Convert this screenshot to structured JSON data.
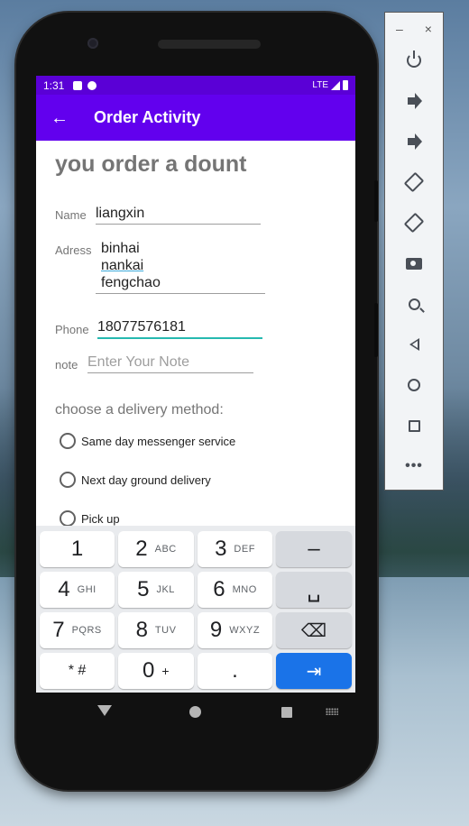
{
  "status_bar": {
    "time": "1:31",
    "network": "LTE"
  },
  "app_bar": {
    "back_glyph": "←",
    "title": "Order Activity"
  },
  "form": {
    "heading": "you order a dount",
    "name_label": "Name",
    "name_value": "liangxin",
    "address_label": "Adress",
    "address_lines": [
      "binhai",
      "nankai",
      "fengchao"
    ],
    "phone_label": "Phone",
    "phone_value": "18077576181",
    "note_label": "note",
    "note_placeholder": "Enter Your Note"
  },
  "delivery": {
    "title": "choose a delivery method:",
    "options": [
      "Same day messenger service",
      "Next day ground delivery",
      "Pick up"
    ]
  },
  "keyboard": {
    "keys": [
      {
        "main": "1",
        "sub": ""
      },
      {
        "main": "2",
        "sub": "ABC"
      },
      {
        "main": "3",
        "sub": "DEF"
      },
      {
        "main": "–",
        "sub": ""
      },
      {
        "main": "4",
        "sub": "GHI"
      },
      {
        "main": "5",
        "sub": "JKL"
      },
      {
        "main": "6",
        "sub": "MNO"
      },
      {
        "main": "␣",
        "sub": ""
      },
      {
        "main": "7",
        "sub": "PQRS"
      },
      {
        "main": "8",
        "sub": "TUV"
      },
      {
        "main": "9",
        "sub": "WXYZ"
      },
      {
        "main": "⌫",
        "sub": ""
      },
      {
        "main": "* #",
        "sub": ""
      },
      {
        "main": "0",
        "sub": "+"
      },
      {
        "main": ".",
        "sub": ""
      },
      {
        "main": "⇥",
        "sub": ""
      }
    ]
  },
  "emulator_toolbar": {
    "minimize": "–",
    "close": "×",
    "more": "•••"
  },
  "colors": {
    "status_bar": "#5a00d6",
    "app_bar": "#6200ee",
    "accent": "#26b9b0",
    "enter_key": "#1a73e8"
  }
}
